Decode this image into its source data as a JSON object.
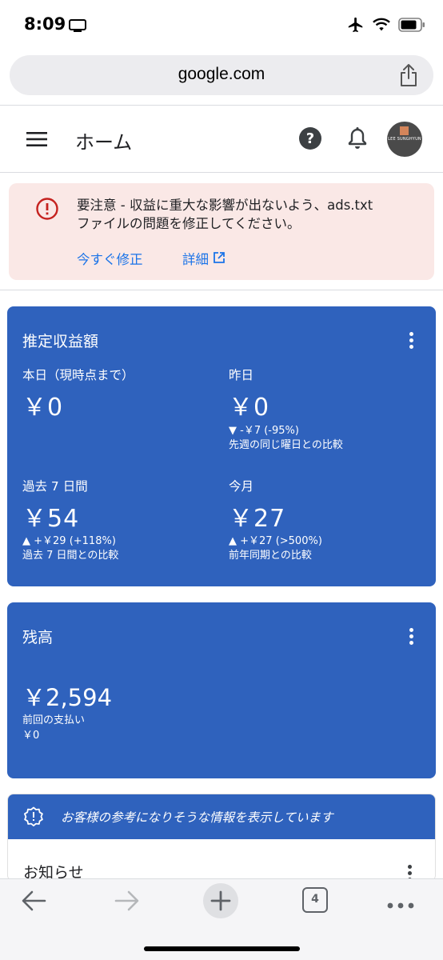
{
  "status_bar": {
    "time": "8:09"
  },
  "browser": {
    "url": "google.com",
    "tab_count": "4"
  },
  "header": {
    "title": "ホーム",
    "avatar_text": "LEE SUNGHYUN"
  },
  "alert": {
    "line1": "要注意 - 収益に重大な影響が出ないよう、ads.txt",
    "line2": "ファイルの問題を修正してください。",
    "fix_label": "今すぐ修正",
    "details_label": "詳細"
  },
  "earnings": {
    "title": "推定収益額",
    "today": {
      "label": "本日（現時点まで）",
      "value": "￥0"
    },
    "yesterday": {
      "label": "昨日",
      "value": "￥0",
      "change": "▼ -￥7 (-95%)",
      "compare": "先週の同じ曜日との比較"
    },
    "last7": {
      "label": "過去 7 日間",
      "value": "￥54",
      "change": "▲ +￥29 (+118%)",
      "compare": "過去 7 日間との比較"
    },
    "month": {
      "label": "今月",
      "value": "￥27",
      "change": "▲ +￥27 (>500%)",
      "compare": "前年同期との比較"
    }
  },
  "balance": {
    "title": "残高",
    "value": "￥2,594",
    "last_payment_label": "前回の支払い",
    "last_payment_value": "￥0"
  },
  "info": {
    "banner_text": "お客様の参考になりそうな情報を表示しています",
    "notice_title": "お知らせ"
  },
  "colors": {
    "card_blue": "#2f62bd",
    "alert_bg": "#fae8e6",
    "alert_red": "#c5221f",
    "link_blue": "#1a73e8"
  }
}
